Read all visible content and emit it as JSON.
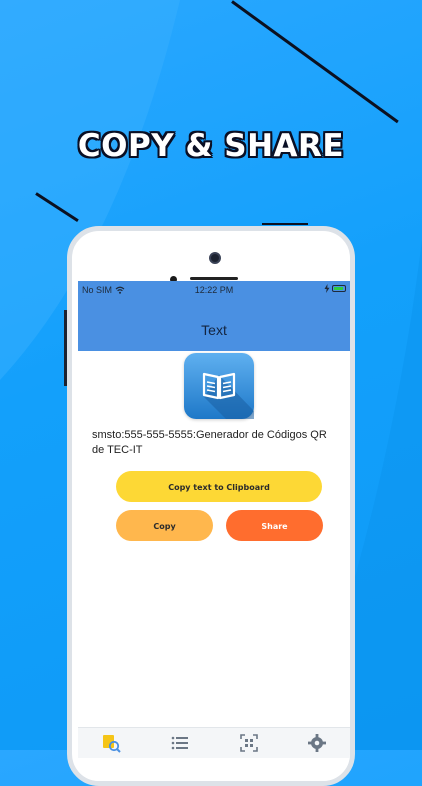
{
  "headline": "COPY & SHARE",
  "status_bar": {
    "carrier": "No SIM",
    "time": "12:22 PM",
    "wifi_icon": "wifi-icon",
    "battery_icon": "battery-charging-icon"
  },
  "nav": {
    "title": "Text"
  },
  "app_icon": "open-book-icon",
  "content": {
    "text": "smsto:555-555-5555:Generador de Códigos QR de TEC-IT"
  },
  "buttons": {
    "copy_to_clipboard": "Copy text to Clipboard",
    "copy": "Copy",
    "share": "Share"
  },
  "tabs": [
    {
      "icon": "scan-history-icon",
      "active": true
    },
    {
      "icon": "list-icon",
      "active": false
    },
    {
      "icon": "qr-scan-icon",
      "active": false
    },
    {
      "icon": "gear-icon",
      "active": false
    }
  ],
  "colors": {
    "background": "#13a0fb",
    "nav_blue": "#4a90e2",
    "yellow": "#fdd835",
    "orange_light": "#ffb74d",
    "orange": "#ff6d2e"
  }
}
